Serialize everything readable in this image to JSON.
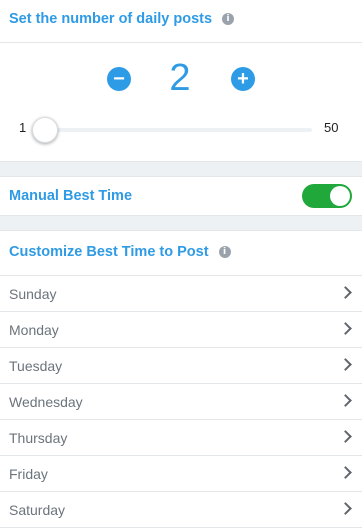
{
  "daily_posts": {
    "title": "Set the number of daily posts",
    "info_icon": "i",
    "decrement_label": "−",
    "increment_label": "+",
    "count": "2",
    "slider": {
      "min_label": "1",
      "max_label": "50",
      "value_fraction": 0.02
    }
  },
  "manual_best_time": {
    "label": "Manual Best Time",
    "enabled": true
  },
  "customize": {
    "title": "Customize Best Time to Post",
    "info_icon": "i",
    "days": [
      "Sunday",
      "Monday",
      "Tuesday",
      "Wednesday",
      "Thursday",
      "Friday",
      "Saturday"
    ]
  },
  "colors": {
    "accent": "#2f9be5",
    "toggle_on": "#21a83b",
    "section_gap": "#eef1f4"
  }
}
